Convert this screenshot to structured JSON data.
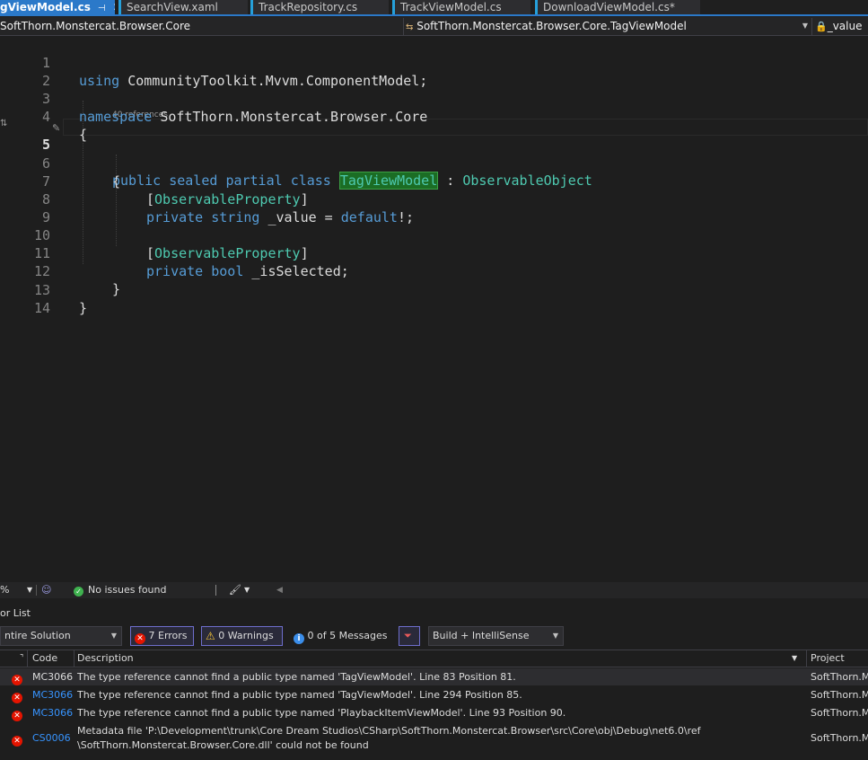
{
  "tabs": [
    {
      "label": "gViewModel.cs",
      "active": true
    },
    {
      "label": "SearchView.xaml"
    },
    {
      "label": "TrackRepository.cs"
    },
    {
      "label": "TrackViewModel.cs"
    },
    {
      "label": "DownloadViewModel.cs*"
    }
  ],
  "navbar": {
    "project": "SoftThorn.Monstercat.Browser.Core",
    "type": "SoftThorn.Monstercat.Browser.Core.TagViewModel",
    "member": "_value"
  },
  "editor": {
    "line_numbers": [
      "1",
      "2",
      "3",
      "4",
      "5",
      "6",
      "7",
      "8",
      "9",
      "10",
      "11",
      "12",
      "13",
      "14"
    ],
    "references": "40 references",
    "line1": {
      "kw": "using",
      "ns": "CommunityToolkit.Mvvm.ComponentModel;"
    },
    "line3": {
      "kw": "namespace",
      "ns": "SoftThorn.Monstercat.Browser.Core"
    },
    "brace_open": "{",
    "brace_close": "}",
    "line5": {
      "m1": "public",
      "m2": "sealed",
      "m3": "partial",
      "m4": "class",
      "name": "TagViewModel",
      "colon": ":",
      "base": "ObservableObject"
    },
    "line7": {
      "lb": "[",
      "attr": "ObservableProperty",
      "rb": "]"
    },
    "line8": {
      "m1": "private",
      "type": "string",
      "rest": "_value =",
      "kw": "default",
      "end": "!;"
    },
    "line10": {
      "lb": "[",
      "attr": "ObservableProperty",
      "rb": "]"
    },
    "line11": {
      "m1": "private",
      "type": "bool",
      "rest": "_isSelected;"
    }
  },
  "editor_status": {
    "zoom": "%",
    "issues": "No issues found"
  },
  "error_list": {
    "title": "or List",
    "scope": "ntire Solution",
    "errors": "7 Errors",
    "warnings": "0 Warnings",
    "messages": "0 of 5 Messages",
    "filter": "Build + IntelliSense",
    "columns": {
      "code": "Code",
      "description": "Description",
      "project": "Project"
    },
    "rows": [
      {
        "code": "MC3066",
        "desc": "The type reference cannot find a public type named 'TagViewModel'. Line 83 Position 81.",
        "project": "SoftThorn.M"
      },
      {
        "code": "MC3066",
        "desc": "The type reference cannot find a public type named 'TagViewModel'. Line 294 Position 85.",
        "project": "SoftThorn.M"
      },
      {
        "code": "MC3066",
        "desc": "The type reference cannot find a public type named 'PlaybackItemViewModel'. Line 93 Position 90.",
        "project": "SoftThorn.M"
      },
      {
        "code": "CS0006",
        "desc": "Metadata file 'P:\\Development\\trunk\\Core Dream Studios\\CSharp\\SoftThorn.Monstercat.Browser\\src\\Core\\obj\\Debug\\net6.0\\ref\n\\SoftThorn.Monstercat.Browser.Core.dll' could not be found",
        "project": "SoftThorn.M"
      }
    ]
  }
}
